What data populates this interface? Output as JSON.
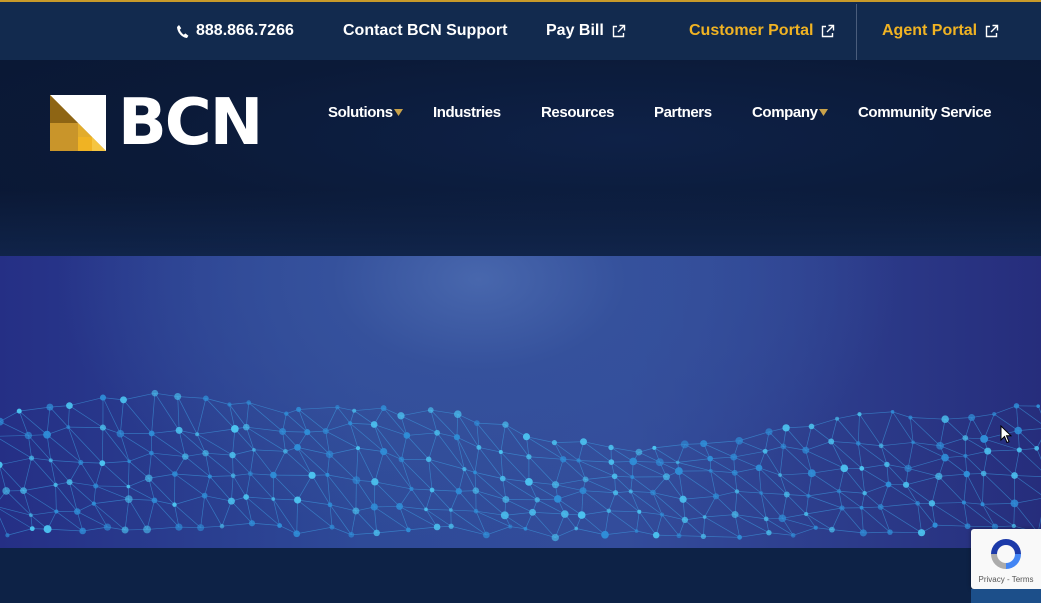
{
  "topbar": {
    "phone": "888.866.7266",
    "contact_support": "Contact BCN Support",
    "pay_bill": "Pay Bill",
    "customer_portal": "Customer Portal",
    "agent_portal": "Agent Portal",
    "accent_color": "#f0b323"
  },
  "header": {
    "logo_text": "BCN",
    "nav": {
      "solutions": "Solutions",
      "industries": "Industries",
      "resources": "Resources",
      "partners": "Partners",
      "company": "Company",
      "community_service": "Community Service"
    }
  },
  "recaptcha": {
    "privacy": "Privacy",
    "separator": " - ",
    "terms": "Terms"
  },
  "icons": {
    "phone": "phone-icon",
    "external_link": "external-link-icon",
    "caret": "caret-down-icon",
    "recaptcha": "recaptcha-icon",
    "cursor": "mouse-cursor-icon"
  },
  "colors": {
    "topbar_bg": "#122a4e",
    "header_bg": "#0b1a38",
    "hero_accent": "#3a8fe0",
    "gold": "#f0b323"
  }
}
